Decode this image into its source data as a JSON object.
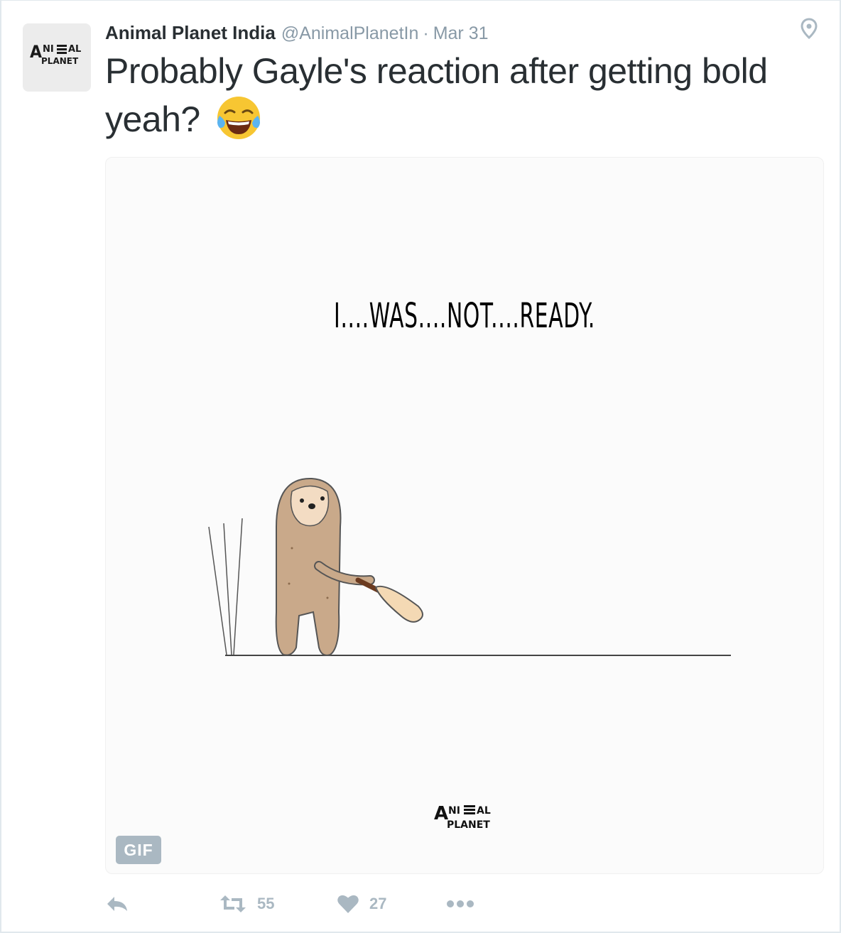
{
  "tweet": {
    "author_name": "Animal Planet India",
    "author_handle": "@AnimalPlanetIn",
    "separator": "·",
    "timestamp": "Mar 31",
    "text": "Probably Gayle's reaction after getting bold yeah?",
    "emoji": "face-with-tears-of-joy",
    "avatar_logo_text": [
      "ANIMAL",
      "PLANET"
    ]
  },
  "media": {
    "caption": "I....WAS....NOT....READY.",
    "watermark_text": [
      "ANIMAL",
      "PLANET"
    ],
    "badge": "GIF"
  },
  "actions": {
    "reply_icon": "reply-icon",
    "retweet_icon": "retweet-icon",
    "retweet_count": "55",
    "like_icon": "heart-icon",
    "like_count": "27",
    "more_icon": "more-dots-icon"
  },
  "colors": {
    "text": "#292f33",
    "secondary": "#8899a6",
    "action": "#aab8c2",
    "border": "#e1e8ed",
    "sloth": "#c9a98a"
  }
}
